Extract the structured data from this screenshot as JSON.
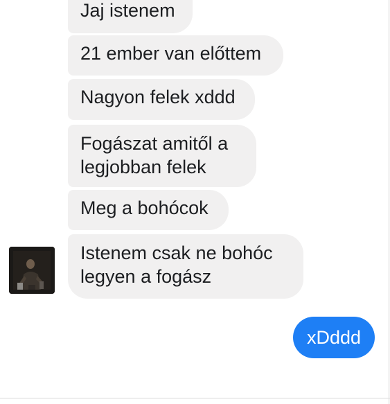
{
  "conversation": {
    "incoming": [
      {
        "text": "Jaj istenem"
      },
      {
        "text": "21 ember van előttem"
      },
      {
        "text": "Nagyon felek xddd"
      },
      {
        "text": "Fogászat amitől a\nlegjobban felek"
      },
      {
        "text": "Meg a bohócok"
      },
      {
        "text": "Istenem csak ne bohóc\nlegyen a fogász"
      }
    ],
    "outgoing": [
      {
        "text": "xDddd"
      }
    ]
  },
  "colors": {
    "incoming_bubble": "#f1f0f0",
    "outgoing_bubble": "#1e7ff5",
    "outgoing_text": "#ffffff"
  },
  "icons": {
    "sender_avatar": "user-avatar"
  }
}
